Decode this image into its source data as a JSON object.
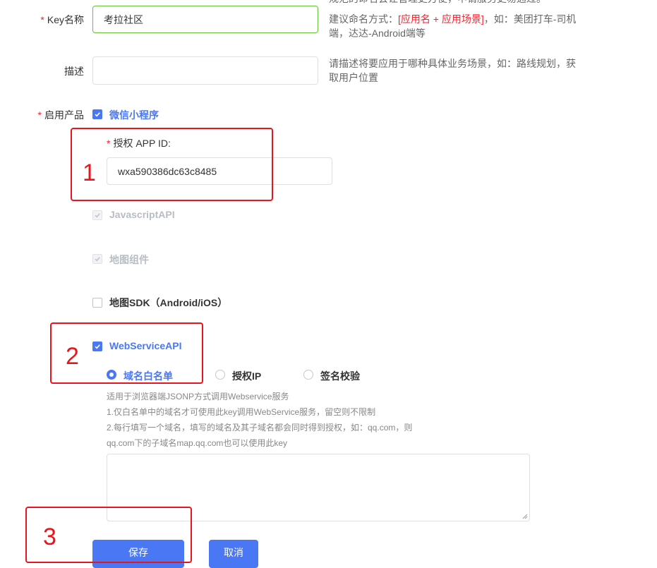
{
  "form": {
    "key_name": {
      "label": "Key名称",
      "required_mark": "*",
      "value": "考拉社区",
      "hint_line0": "规范的命名会让管理更方便，申请服务更易通过。",
      "hint_prefix": "建议命名方式：",
      "hint_highlight": "[应用名 + 应用场景]",
      "hint_suffix": "，如：美团打车-司机",
      "hint_line2": "端，达达-Android端等"
    },
    "description": {
      "label": "描述",
      "value": "",
      "hint_line1": "请描述将要应用于哪种具体业务场景，如：路线规划，获",
      "hint_line2": "取用户位置"
    },
    "products": {
      "label": "启用产品",
      "required_mark": "*",
      "wechat_miniprogram": {
        "label": "微信小程序",
        "checked": true
      },
      "app_id": {
        "label": "授权 APP ID:",
        "required_mark": "*",
        "value": "wxa590386dc63c8485"
      },
      "javascript_api": {
        "label": "JavascriptAPI",
        "checked": true,
        "disabled": true
      },
      "map_component": {
        "label": "地图组件",
        "checked": true,
        "disabled": true
      },
      "map_sdk": {
        "label": "地图SDK（Android/iOS）",
        "checked": false
      },
      "webservice_api": {
        "label": "WebServiceAPI",
        "checked": true,
        "auth_options": [
          {
            "label": "域名白名单",
            "selected": true
          },
          {
            "label": "授权IP",
            "selected": false
          },
          {
            "label": "签名校验",
            "selected": false
          }
        ],
        "help_line1": "适用于浏览器端JSONP方式调用Webservice服务",
        "help_line2": "1.仅白名单中的域名才可使用此key调用WebService服务，留空则不限制",
        "help_line3": "2.每行填写一个域名，填写的域名及其子域名都会同时得到授权，如：qq.com，则",
        "help_line4": "qq.com下的子域名map.qq.com也可以使用此key",
        "whitelist_value": ""
      }
    },
    "actions": {
      "save_label": "保存",
      "cancel_label": "取消"
    }
  },
  "annotations": {
    "n1": "1",
    "n2": "2",
    "n3": "3"
  },
  "colors": {
    "primary": "#4a78f5",
    "required": "#f5222d",
    "annotation": "#e8151c",
    "focus_border": "#67c23a"
  }
}
